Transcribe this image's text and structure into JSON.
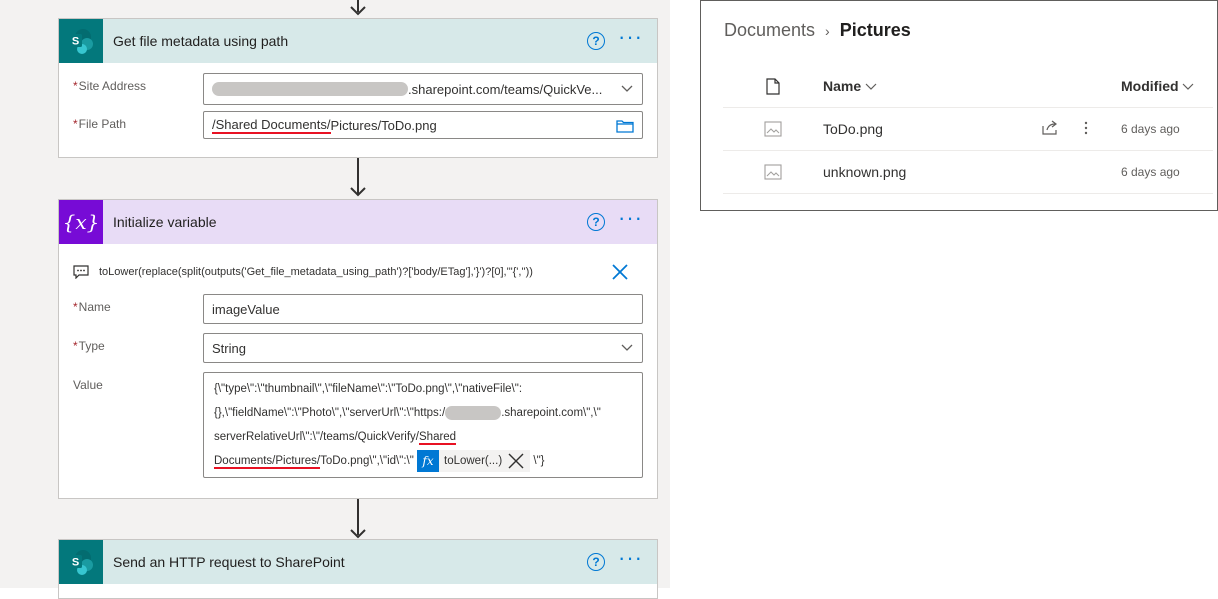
{
  "flow": {
    "card1": {
      "title": "Get file metadata using path",
      "help": "?",
      "more": "···",
      "site_address_label": "Site Address",
      "site_address_value": ".sharepoint.com/teams/QuickVe...",
      "file_path_label": "File Path",
      "file_path_value_underlined": "/Shared Documents/",
      "file_path_value_rest": "Pictures/ToDo.png"
    },
    "card2": {
      "title": "Initialize variable",
      "icon_text": "{x}",
      "help": "?",
      "more": "···",
      "expression": "toLower(replace(split(outputs('Get_file_metadata_using_path')?['body/ETag'],'}')?[0],'\"{',''))",
      "name_label": "Name",
      "name_value": "imageValue",
      "type_label": "Type",
      "type_value": "String",
      "value_label": "Value",
      "value_line1": "{\\\"type\\\":\\\"thumbnail\\\",\\\"fileName\\\":\\\"ToDo.png\\\",\\\"nativeFile\\\":",
      "value_line2a": "{},\\\"fieldName\\\":\\\"Photo\\\",\\\"serverUrl\\\":\\\"https:/",
      "value_line2b": ".sharepoint.com\\\",\\\"",
      "value_line3a": "serverRelativeUrl\\\":\\\"/teams/QuickVerify/",
      "value_line3b": "Shared",
      "value_line4a": "Documents/Pictures/",
      "value_line4b": "ToDo.png\\\",\\\"id\\\":\\\"",
      "fx_token_icon": "fx",
      "fx_token_label": "toLower(...)",
      "value_line4c": "\\\"}"
    },
    "card3": {
      "title": "Send an HTTP request to SharePoint",
      "help": "?",
      "more": "···"
    }
  },
  "sharepoint": {
    "breadcrumb_root": "Documents",
    "breadcrumb_sep": "›",
    "breadcrumb_current": "Pictures",
    "col_name": "Name",
    "col_modified": "Modified",
    "files": [
      {
        "name": "ToDo.png",
        "modified": "6 days ago"
      },
      {
        "name": "unknown.png",
        "modified": "6 days ago"
      }
    ]
  },
  "colors": {
    "sharepoint_teal": "#03787c",
    "variable_purple": "#770bd6",
    "accent_blue": "#0078d4",
    "underline_red": "#e81123"
  }
}
